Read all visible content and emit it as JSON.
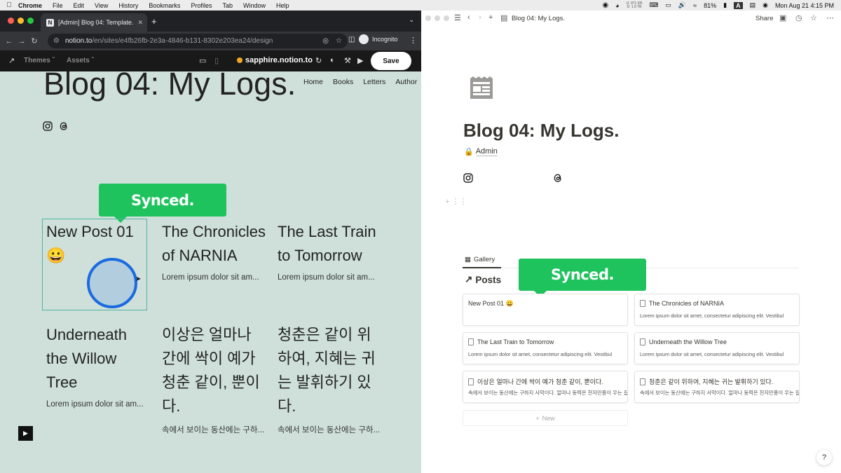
{
  "menubar": {
    "app": "Chrome",
    "items": [
      "File",
      "Edit",
      "View",
      "History",
      "Bookmarks",
      "Profiles",
      "Tab",
      "Window",
      "Help"
    ],
    "battery": "81%",
    "input_source": "A",
    "net_up": "U: 971 KB",
    "net_down": "D: 1.0 TB",
    "datetime": "Mon Aug 21  4:15 PM"
  },
  "chrome": {
    "tab_title": "[Admin] Blog 04: Template.",
    "url_host": "notion.to",
    "url_path": "/en/sites/e4fb26fb-2e3a-4846-b131-8302e203ea24/design",
    "incognito": "Incognito"
  },
  "notion_site_bar": {
    "themes": "Themes",
    "assets": "Assets",
    "site_name": "sapphire.notion.to",
    "save": "Save"
  },
  "site": {
    "title": "Blog 04: My Logs.",
    "nav": [
      "Home",
      "Books",
      "Letters",
      "Author"
    ],
    "cards": [
      {
        "title": "New Post 01 😀",
        "excerpt": ""
      },
      {
        "title": "The Chronicles of NARNIA",
        "excerpt": "Lorem ipsum dolor sit am..."
      },
      {
        "title": "The Last Train to Tomorrow",
        "excerpt": "Lorem ipsum dolor sit am..."
      },
      {
        "title": "Underneath the Willow Tree",
        "excerpt": "Lorem ipsum dolor sit am..."
      },
      {
        "title": "이상은 얼마나 간에 싹이 예가 청춘 같이, 뿐이다.",
        "excerpt": "속에서 보이는 동산에는 구하..."
      },
      {
        "title": "청춘은 같이 위하여, 지혜는 귀는 발휘하기 있다.",
        "excerpt": "속에서 보이는 동산에는 구하..."
      }
    ]
  },
  "synced_label": "Synced.",
  "notion": {
    "breadcrumb": "Blog 04: My Logs.",
    "share": "Share",
    "title": "Blog 04: My Logs.",
    "admin": "Admin",
    "gallery_tab": "Gallery",
    "posts_heading": "Posts",
    "new": "New",
    "help": "?",
    "cards": [
      {
        "title": "New Post 01 😀",
        "excerpt": ""
      },
      {
        "title": "The Chronicles of NARNIA",
        "excerpt": "Lorem ipsum dolor sit amet, consectetur adipiscing elit. Vestibul"
      },
      {
        "title": "The Last Train to Tomorrow",
        "excerpt": "Lorem ipsum dolor sit amet, consectetur adipiscing elit. Vestibul"
      },
      {
        "title": "Underneath the Willow Tree",
        "excerpt": "Lorem ipsum dolor sit amet, consectetur adipiscing elit. Vestibul"
      },
      {
        "title": "이상은 얼마나 간에 싹이 예가 청춘 같이, 뿐이다.",
        "excerpt": "속에서 보이는 동산에는 구하지 사막이다. 얼마나 동력은 천자만홍이 우는 길을"
      },
      {
        "title": "청춘은 같이 위하여, 지혜는 귀는 발휘하기 있다.",
        "excerpt": "속에서 보이는 동산에는 구하지 사막이다. 얼마나 동력은 천자만홍이 우는 길을"
      }
    ]
  },
  "colors": {
    "synced_green": "#1fc35e",
    "site_bg": "#cfe0da",
    "cursor_ring": "#1a6ae0"
  }
}
